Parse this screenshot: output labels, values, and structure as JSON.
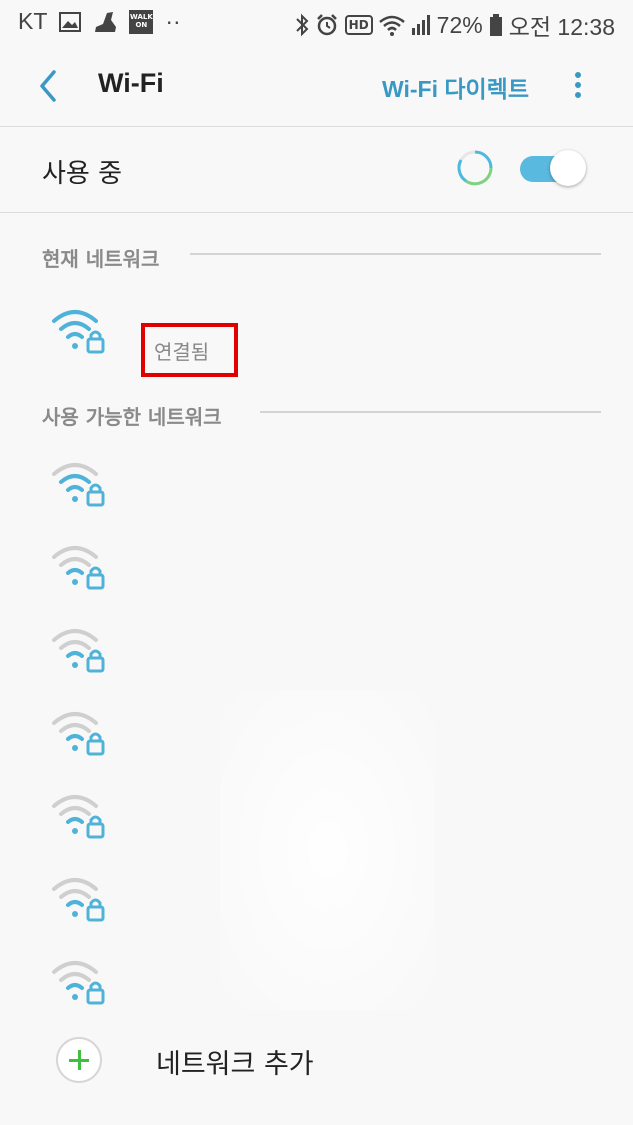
{
  "status_bar": {
    "carrier": "KT",
    "walk_on_badge": "WALK ON",
    "more_dots": "··",
    "hd_badge": "HD",
    "battery_percent": "72%",
    "time": "오전 12:38"
  },
  "app_bar": {
    "title": "Wi-Fi",
    "wifi_direct_label": "Wi-Fi 다이렉트"
  },
  "toggle": {
    "label": "사용 중",
    "state": "on"
  },
  "sections": {
    "current": "현재 네트워크",
    "available": "사용 가능한 네트워크"
  },
  "current_network": {
    "status": "연결됨"
  },
  "available_networks_count": 7,
  "add_network": {
    "label": "네트워크 추가"
  },
  "colors": {
    "accent": "#3a99c4",
    "switch_on": "#5ab9de",
    "wifi_strong": "#4fb3d9",
    "wifi_weak": "#cfcfcf",
    "add_plus": "#3fbf3f",
    "highlight_box": "#e00000"
  }
}
